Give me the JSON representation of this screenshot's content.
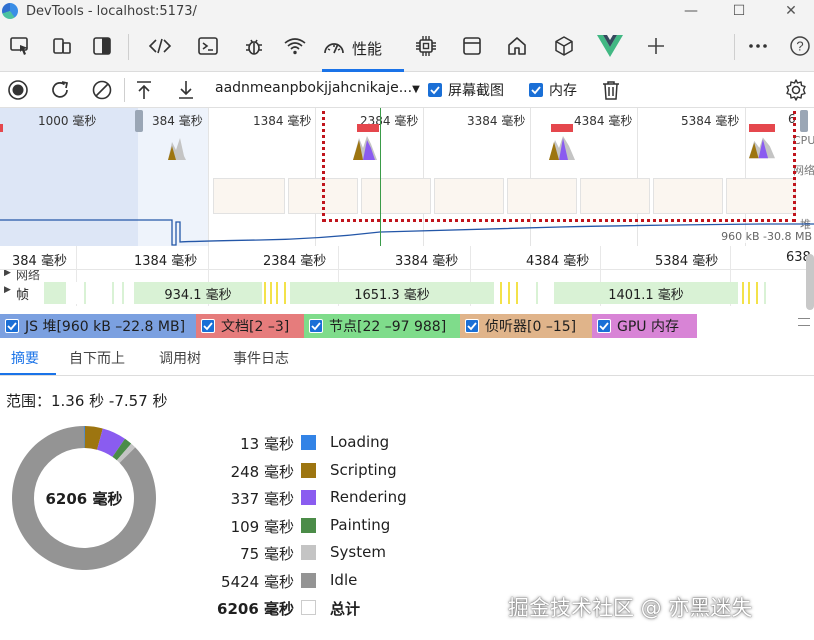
{
  "window": {
    "title": "DevTools - localhost:5173/"
  },
  "toolbar": {
    "perf_tab_label": "性能"
  },
  "perfbar": {
    "profile_select": "aadnmeanpbokjjahcnikaje...",
    "screenshot_label": "屏幕截图",
    "memory_label": "内存"
  },
  "overview": {
    "labels": [
      "1000  毫秒",
      "384  毫秒",
      "1384  毫秒",
      "2384  毫秒",
      "3384  毫秒",
      "4384  毫秒",
      "5384  毫秒",
      "6"
    ],
    "right_labels": [
      "CPU",
      "网络",
      "堆"
    ],
    "memory_range": "960 kB -30.8 MB"
  },
  "ruler": {
    "labels": [
      "384  毫秒",
      "1384  毫秒",
      "2384  毫秒",
      "3384  毫秒",
      "4384  毫秒",
      "5384  毫秒",
      "638"
    ]
  },
  "tracks": {
    "network_label": "网络",
    "frames_label": "帧",
    "frames": [
      "934.1  毫秒",
      "1651.3  毫秒",
      "1401.1  毫秒"
    ]
  },
  "counters": [
    {
      "label": "JS 堆[960 kB –22.8 MB]",
      "color": "#7ba0e0"
    },
    {
      "label": "文档[2 –3]",
      "color": "#e67c7c"
    },
    {
      "label": "节点[22 –97 988]",
      "color": "#7fdc8b"
    },
    {
      "label": "侦听器[0 –15]",
      "color": "#e0b48a"
    },
    {
      "label": "GPU 内存",
      "color": "#d884d6"
    }
  ],
  "subtabs": [
    "摘要",
    "自下而上",
    "调用树",
    "事件日志"
  ],
  "summary": {
    "range": "范围：1.36 秒 -7.57 秒",
    "total_label": "6206  毫秒",
    "rows": [
      {
        "value": "13  毫秒",
        "name": "Loading",
        "color": "#3283e6",
        "ms": 13
      },
      {
        "value": "248  毫秒",
        "name": "Scripting",
        "color": "#9d7510",
        "ms": 248
      },
      {
        "value": "337  毫秒",
        "name": "Rendering",
        "color": "#8a5cf0",
        "ms": 337
      },
      {
        "value": "109  毫秒",
        "name": "Painting",
        "color": "#4b8c48",
        "ms": 109
      },
      {
        "value": "75  毫秒",
        "name": "System",
        "color": "#c4c4c4",
        "ms": 75
      },
      {
        "value": "5424  毫秒",
        "name": "Idle",
        "color": "#949494",
        "ms": 5424
      },
      {
        "value": "6206  毫秒",
        "name": "总计",
        "color": "#ffffff",
        "ms": 6206
      }
    ]
  },
  "watermark": "掘金技术社区 @ 亦黑迷失"
}
